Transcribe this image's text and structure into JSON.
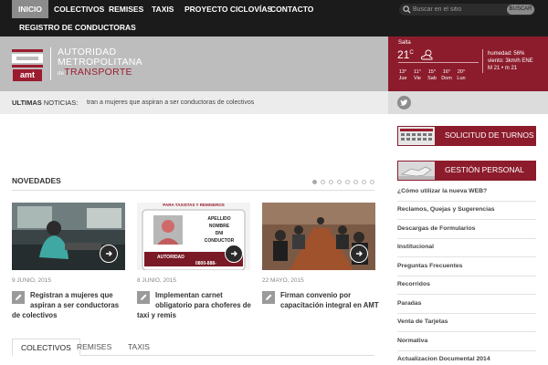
{
  "nav": {
    "items": [
      "Inicio",
      "Colectivos",
      "Remises",
      "Taxis",
      "Proyecto Ciclovías",
      "Contacto"
    ],
    "second_row": "Registro de Conductoras",
    "active_index": 0
  },
  "search": {
    "placeholder": "Buscar en el sitio",
    "button_label": "BUSCAR"
  },
  "logo": {
    "abbr": "amt",
    "line1": "Autoridad",
    "line2": "Metropolitana",
    "line3_small": "de",
    "line3": "Transporte"
  },
  "weather": {
    "city": "Salta",
    "temp": "21",
    "unit": "C",
    "humidity": "humedad: 56%",
    "wind": "viento: 3km/h ENE",
    "range": "M 21 • m 21",
    "icon": "partly-cloudy-icon",
    "forecast": [
      {
        "temp": "13°",
        "day": "Jue"
      },
      {
        "temp": "11°",
        "day": "Vie"
      },
      {
        "temp": "15°",
        "day": "Sab"
      },
      {
        "temp": "16°",
        "day": "Dom"
      },
      {
        "temp": "20°",
        "day": "Lun"
      }
    ]
  },
  "ticker": {
    "label_bold": "ULTIMAS",
    "label_rest": " NOTICIAS:",
    "text": "tran a mujeres que aspiran a ser conductoras de colectivos"
  },
  "social": {
    "icon": "twitter-icon"
  },
  "sidebar": {
    "banners": [
      "Solicitud de Turnos",
      "Gestión Personal"
    ],
    "links": [
      "¿Cómo utilizar la nueva WEB?",
      "Reclamos, Quejas y Sugerencias",
      "Descargas de Formularios",
      "Institucional",
      "Preguntas Frecuentes",
      "Recorridos",
      "Paradas",
      "Venta de Tarjetas",
      "Normativa",
      "Actualizacion Documental 2014"
    ]
  },
  "novedades": {
    "title": "Novedades",
    "slider_dots": 8,
    "active_dot": 0,
    "cards": [
      {
        "date": "9 Junio, 2015",
        "title_l1": "Registran a mujeres que",
        "title_l2": "aspiran a ser conductoras",
        "title_l3": "de colectivos"
      },
      {
        "date": "8 Junio, 2015",
        "title_l1": "Implementan carnet",
        "title_l2": "obligatorio para choferes de",
        "title_l3": "taxi y remis"
      },
      {
        "date": "22 Mayo, 2015",
        "title_l1": "Firman convenio por",
        "title_l2": "capacitación integral en AMT",
        "title_l3": ""
      }
    ],
    "card2_image_text": {
      "top": "Para Taxistas y Remiseros",
      "lines": [
        "APELLIDO",
        "NOMBRE",
        "DNI",
        "CONDUCTOR"
      ],
      "org": "AUTORIDAD",
      "phone": "0800-888-"
    }
  },
  "tabs": [
    "Colectivos",
    "Remises",
    "Taxis"
  ],
  "colors": {
    "accent": "#8c1c2c",
    "nav_bg": "#1b1b1b",
    "header_gray": "#bdbdbd"
  }
}
